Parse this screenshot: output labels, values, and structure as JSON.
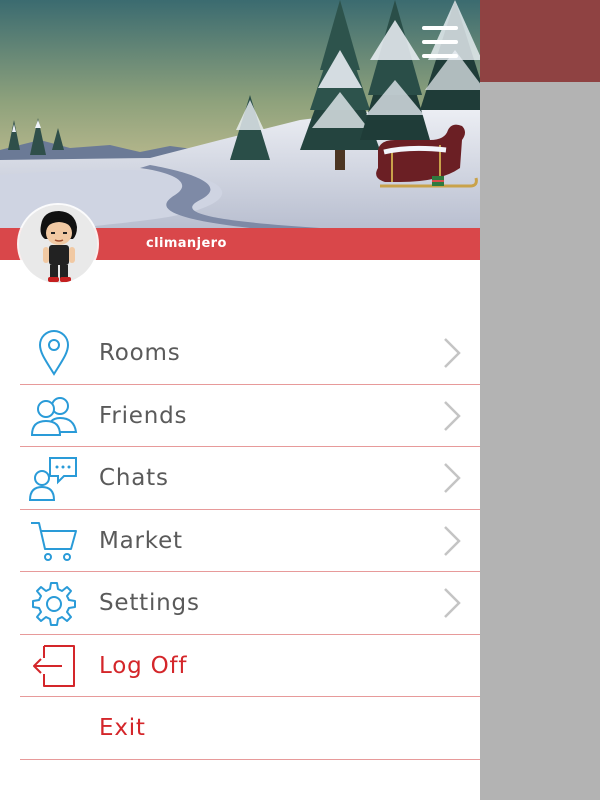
{
  "user": {
    "name": "climanjero"
  },
  "menu": {
    "items": [
      {
        "label": "Rooms",
        "icon": "location-pin-icon",
        "chevron": true,
        "color": "#5a5a5a"
      },
      {
        "label": "Friends",
        "icon": "friends-icon",
        "chevron": true,
        "color": "#5a5a5a"
      },
      {
        "label": "Chats",
        "icon": "chat-icon",
        "chevron": true,
        "color": "#5a5a5a"
      },
      {
        "label": "Market",
        "icon": "cart-icon",
        "chevron": true,
        "color": "#5a5a5a"
      },
      {
        "label": "Settings",
        "icon": "gear-icon",
        "chevron": true,
        "color": "#5a5a5a"
      },
      {
        "label": "Log Off",
        "icon": "logout-icon",
        "chevron": false,
        "color": "#d4262a"
      },
      {
        "label": "Exit",
        "icon": "",
        "chevron": false,
        "color": "#d4262a"
      }
    ]
  },
  "colors": {
    "accent": "#d9474a",
    "icon_blue": "#2a9bd8",
    "topbar": "#8f4242",
    "overlay": "#b3b3b3"
  },
  "header": {
    "image": "winter-scene-header-image"
  }
}
